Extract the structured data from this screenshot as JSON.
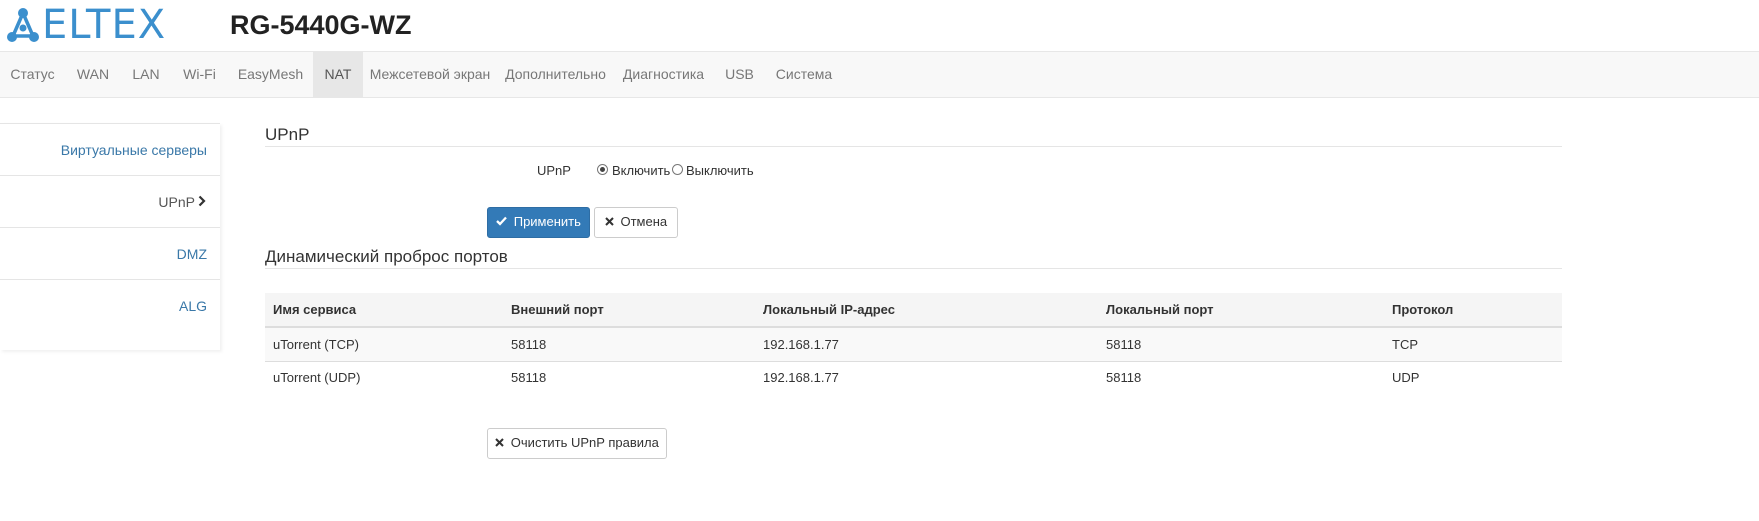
{
  "header": {
    "logo_text": "ELTEX",
    "logo_icon": "eltex-network-icon",
    "model": "RG-5440G-WZ"
  },
  "nav": {
    "items": [
      "Статус",
      "WAN",
      "LAN",
      "Wi-Fi",
      "EasyMesh",
      "NAT",
      "Межсетевой экран",
      "Дополнительно",
      "Диагностика",
      "USB",
      "Система"
    ],
    "active": "NAT"
  },
  "sidebar": {
    "items": [
      "Виртуальные серверы",
      "UPnP",
      "DMZ",
      "ALG"
    ],
    "active": "UPnP"
  },
  "upnp": {
    "title": "UPnP",
    "field_label": "UPnP",
    "enable_label": "Включить",
    "disable_label": "Выключить",
    "selected": "Включить",
    "apply_label": "Применить",
    "cancel_label": "Отмена"
  },
  "ports": {
    "title": "Динамический проброс портов",
    "columns": [
      "Имя сервиса",
      "Внешний порт",
      "Локальный IP-адрес",
      "Локальный порт",
      "Протокол"
    ],
    "rows": [
      [
        "uTorrent (TCP)",
        "58118",
        "192.168.1.77",
        "58118",
        "TCP"
      ],
      [
        "uTorrent (UDP)",
        "58118",
        "192.168.1.77",
        "58118",
        "UDP"
      ]
    ],
    "clear_label": "Очистить UPnP правила"
  },
  "colors": {
    "brand": "#3b8fcd",
    "primary_button": "#337ab7",
    "link": "#3a78a8"
  }
}
